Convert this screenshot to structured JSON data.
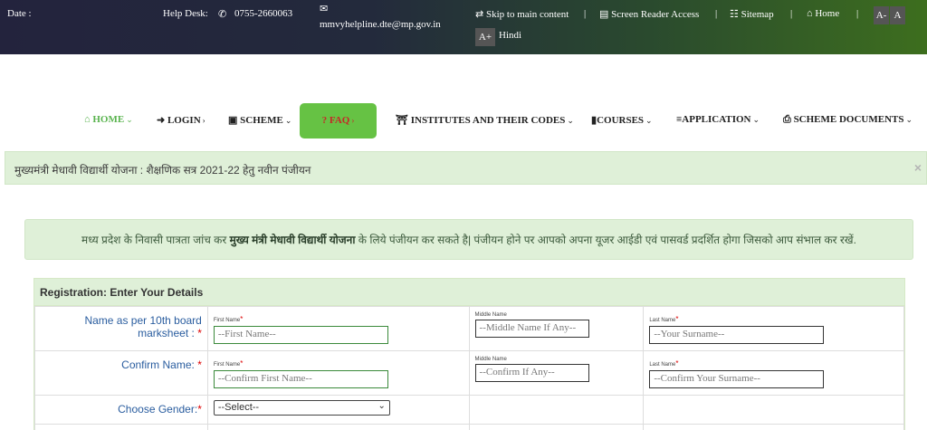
{
  "topbar": {
    "date_label": "Date :",
    "helpdesk_label": "Help Desk:",
    "phone_icon": "phone-icon",
    "phone": "0755-2660063",
    "email_icon": "envelope-icon",
    "email": "mmvyhelpline.dte@mp.gov.in",
    "skip": "Skip to main content",
    "screen_reader": "Screen Reader Access",
    "sitemap": "Sitemap",
    "home": "Home",
    "font_minus": "A-",
    "font_normal": "A",
    "font_plus": "A+",
    "hindi": "Hindi",
    "separator": "|"
  },
  "nav": {
    "home": "HOME",
    "login": "LOGIN",
    "scheme": "SCHEME",
    "faq": "? FAQ",
    "institutes": "INSTITUTES AND THEIR CODES",
    "courses": "COURSES",
    "application": "APPLICATION",
    "scheme_documents": "SCHEME DOCUMENTS"
  },
  "alert": {
    "text": "मुख्यमंत्री मेधावी विद्यार्थी योजना : शैक्षणिक सत्र 2021-22 हेतु नवीन पंजीयन",
    "close": "×"
  },
  "info": {
    "pre": "मध्य प्रदेश के निवासी पात्रता जांच कर ",
    "bold": "मुख्य मंत्री मेधावी विद्यार्थी योजना",
    "post": " के लिये पंजीयन कर सकते है|  पंजीयन होने पर आपको अपना यूजर आईडी एवं पासवर्ड प्रदर्शित होगा जिसको आप संभाल कर रखें."
  },
  "form": {
    "title": "Registration: Enter Your Details",
    "name_label": "Name  as per 10th board marksheet :",
    "confirm_label": "Confirm Name:",
    "gender_label": "Choose Gender:",
    "required": "*",
    "first_name_small": "First Name",
    "middle_name_small": "Middle Name",
    "last_name_small": "Last Name",
    "first_name_placeholder": "--First Name--",
    "middle_name_placeholder": "--Middle Name If Any--",
    "last_name_placeholder": "--Your Surname--",
    "confirm_first_placeholder": "--Confirm First Name--",
    "confirm_middle_placeholder": "--Confirm If Any--",
    "confirm_last_placeholder": "--Confirm Your Surname--",
    "gender_selected": "--Select--"
  }
}
